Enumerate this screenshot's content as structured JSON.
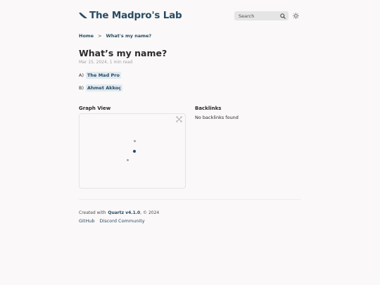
{
  "site": {
    "title": "The Madpro's Lab"
  },
  "search": {
    "placeholder": "Search"
  },
  "breadcrumb": {
    "home": "Home",
    "separator": ">",
    "current": "What's my name?"
  },
  "article": {
    "title": "What’s my name?",
    "meta": "Mar 15, 2024, 1 min read",
    "lines": [
      {
        "prefix": "A)",
        "tag": "The Mad Pro"
      },
      {
        "prefix": "B)",
        "tag": "Ahmet Akkoç"
      }
    ]
  },
  "graph": {
    "title": "Graph View"
  },
  "backlinks": {
    "title": "Backlinks",
    "empty": "No backlinks found"
  },
  "footer": {
    "created_prefix": "Created with",
    "quartz_link": "Quartz v4.1.0",
    "year_text": ", © 2024",
    "links": [
      "GitHub",
      "Discord Community"
    ]
  },
  "colors": {
    "accent": "#284b63",
    "secondary": "#a3a3a3",
    "background": "#faf8f8"
  }
}
